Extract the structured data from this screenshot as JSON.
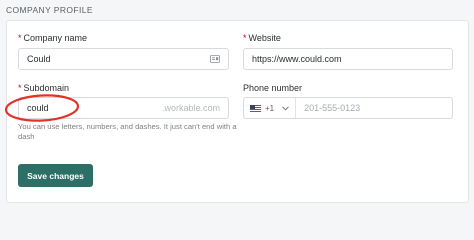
{
  "section": {
    "title": "COMPANY PROFILE"
  },
  "form": {
    "company_name": {
      "label": "Company name",
      "required_mark": "*",
      "value": "Could"
    },
    "website": {
      "label": "Website",
      "required_mark": "*",
      "value": "https://www.could.com"
    },
    "subdomain": {
      "label": "Subdomain",
      "required_mark": "*",
      "value": "could",
      "suffix": ".workable.com",
      "helper": "You can use letters, numbers, and dashes. It just can't end with a dash"
    },
    "phone": {
      "label": "Phone number",
      "dial_code": "+1",
      "placeholder": "201-555-0123"
    }
  },
  "actions": {
    "save_label": "Save changes"
  },
  "colors": {
    "primary": "#2d6f67",
    "required": "#d0021b",
    "annotation": "#e0332a"
  },
  "icons": {
    "company_name": "contact-card-icon",
    "country_flag": "us-flag-icon",
    "country_dropdown": "chevron-down-icon"
  }
}
